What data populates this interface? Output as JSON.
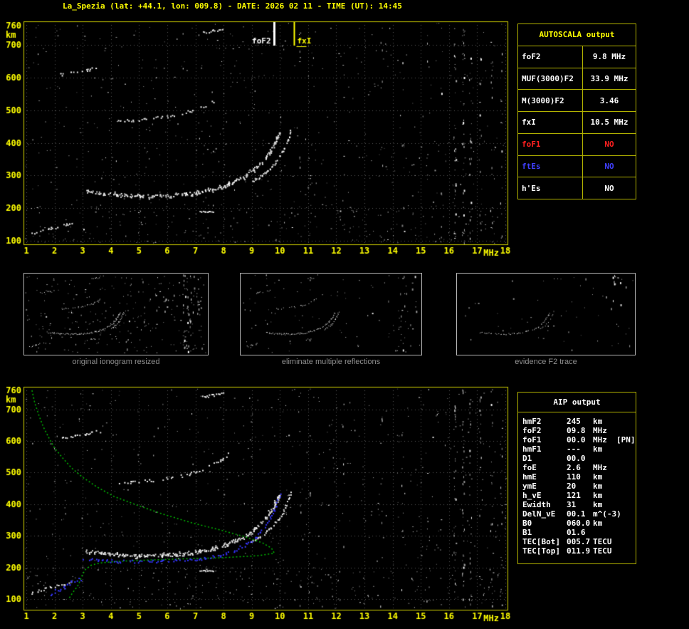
{
  "header": {
    "title": "La_Spezia (lat: +44.1, lon: 009.8) - DATE: 2026 02 11 - TIME (UT): 14:45"
  },
  "colors": {
    "background": "#000000",
    "axis_labels": "#ffff00",
    "plot_border": "#c8c800",
    "panel_border": "#b2b200",
    "trace_white": "#ffffff",
    "profile_green": "#00bb00",
    "restored_blue": "#3535ff",
    "fof1_red": "#ff2020",
    "ftes_blue": "#4040ff"
  },
  "autoscala": {
    "title": "AUTOSCALA output",
    "rows": [
      {
        "label": "foF2",
        "value": "9.8 MHz",
        "color": "#ffffff"
      },
      {
        "label": "MUF(3000)F2",
        "value": "33.9 MHz",
        "color": "#ffffff"
      },
      {
        "label": "M(3000)F2",
        "value": "3.46",
        "color": "#ffffff"
      },
      {
        "label": "fxI",
        "value": "10.5 MHz",
        "color": "#ffffff"
      },
      {
        "label": "foF1",
        "value": "NO",
        "color": "#ff2020"
      },
      {
        "label": "ftEs",
        "value": "NO",
        "color": "#4040ff"
      },
      {
        "label": "h'Es",
        "value": "NO",
        "color": "#ffffff"
      }
    ]
  },
  "thumbnails": [
    {
      "caption": "original ionogram resized"
    },
    {
      "caption": "eliminate multiple reflections"
    },
    {
      "caption": "evidence F2 trace"
    }
  ],
  "aip": {
    "title": "AIP output",
    "rows": [
      {
        "name": "hmF2",
        "value": "245",
        "unit": "km",
        "extra": ""
      },
      {
        "name": "foF2",
        "value": "09.8",
        "unit": "MHz",
        "extra": ""
      },
      {
        "name": "foF1",
        "value": "00.0",
        "unit": "MHz",
        "extra": "[PN]"
      },
      {
        "name": "hmF1",
        "value": "---",
        "unit": "km",
        "extra": ""
      },
      {
        "name": "D1",
        "value": "00.0",
        "unit": "",
        "extra": ""
      },
      {
        "name": "foE",
        "value": "2.6",
        "unit": "MHz",
        "extra": ""
      },
      {
        "name": "hmE",
        "value": "110",
        "unit": "km",
        "extra": ""
      },
      {
        "name": "ymE",
        "value": "20",
        "unit": "km",
        "extra": ""
      },
      {
        "name": "h_vE",
        "value": "121",
        "unit": "km",
        "extra": ""
      },
      {
        "name": "Ewidth",
        "value": "31",
        "unit": "km",
        "extra": ""
      },
      {
        "name": "DelN_vE",
        "value": "00.1",
        "unit": "m^(-3)",
        "extra": ""
      },
      {
        "name": "B0",
        "value": "060.0",
        "unit": "km",
        "extra": ""
      },
      {
        "name": "B1",
        "value": "01.6",
        "unit": "",
        "extra": ""
      },
      {
        "name": "TEC[Bot]",
        "value": "005.7",
        "unit": "TECU",
        "extra": ""
      },
      {
        "name": "TEC[Top]",
        "value": "011.9",
        "unit": "TECU",
        "extra": ""
      }
    ]
  },
  "chart_data": [
    {
      "id": "main_ionogram",
      "type": "scatter",
      "title": "scaled ionogram with AUTOSCALA frequency markers",
      "xlabel": "MHz",
      "ylabel": "km",
      "xlim": [
        1,
        18
      ],
      "ylim": [
        100,
        760
      ],
      "x_ticks": [
        1,
        2,
        3,
        4,
        5,
        6,
        7,
        8,
        9,
        10,
        11,
        12,
        13,
        14,
        15,
        16,
        17,
        18
      ],
      "y_ticks": [
        100,
        200,
        300,
        400,
        500,
        600,
        700,
        760
      ],
      "grid": true,
      "grid_color": "#585858",
      "border_color": "#c8c800",
      "annotations": [
        {
          "label": "foF2",
          "x": 9.8,
          "color": "#ffffff",
          "side": "left",
          "lw": 3
        },
        {
          "label": "fxI",
          "x": 10.5,
          "color": "#ffff00",
          "side": "right",
          "lw": 2,
          "underline": true
        }
      ],
      "traces": [
        {
          "name": "Es-trace",
          "points": [
            [
              1.15,
              122
            ],
            [
              1.5,
              130
            ],
            [
              1.9,
              139
            ],
            [
              2.3,
              148
            ],
            [
              2.65,
              157
            ]
          ],
          "keep": 0.55,
          "jitter": 1.5
        },
        {
          "name": "F2-trace",
          "points": [
            [
              3.1,
              254
            ],
            [
              3.6,
              248
            ],
            [
              4.2,
              243
            ],
            [
              5.0,
              239
            ],
            [
              5.8,
              239
            ],
            [
              6.5,
              243
            ],
            [
              7.1,
              250
            ],
            [
              7.6,
              259
            ],
            [
              8.0,
              270
            ],
            [
              8.4,
              284
            ],
            [
              8.8,
              303
            ],
            [
              9.15,
              326
            ],
            [
              9.45,
              352
            ],
            [
              9.65,
              375
            ],
            [
              9.8,
              398
            ],
            [
              9.9,
              416
            ],
            [
              9.97,
              432
            ]
          ],
          "keep": 0.9,
          "jitter": 1.6,
          "thick": true
        },
        {
          "name": "F2-trace-x",
          "points": [
            [
              9.0,
              282
            ],
            [
              9.35,
              302
            ],
            [
              9.65,
              325
            ],
            [
              9.9,
              350
            ],
            [
              10.08,
              375
            ],
            [
              10.2,
              398
            ],
            [
              10.3,
              420
            ],
            [
              10.36,
              438
            ]
          ],
          "keep": 0.75,
          "jitter": 1.2
        },
        {
          "name": "F2-second-hop",
          "points": [
            [
              4.25,
              467
            ],
            [
              4.8,
              471
            ],
            [
              5.4,
              476
            ],
            [
              6.0,
              483
            ],
            [
              6.6,
              493
            ],
            [
              7.1,
              506
            ],
            [
              7.5,
              521
            ],
            [
              7.85,
              540
            ],
            [
              8.15,
              560
            ]
          ],
          "keep": 0.45,
          "jitter": 1.4
        },
        {
          "name": "multiple-upper",
          "points": [
            [
              2.2,
              612
            ],
            [
              2.7,
              618
            ],
            [
              3.2,
              626
            ],
            [
              3.65,
              634
            ]
          ],
          "keep": 0.5,
          "jitter": 1.6
        },
        {
          "name": "top-trace",
          "points": [
            [
              7.25,
              740
            ],
            [
              7.6,
              746
            ],
            [
              7.95,
              751
            ]
          ],
          "keep": 0.7,
          "jitter": 1.2
        },
        {
          "name": "dash-190",
          "points": [
            [
              7.15,
              191
            ],
            [
              7.62,
              191
            ]
          ],
          "keep": 0.9,
          "jitter": 0.5
        }
      ],
      "noise_points": 520,
      "noise_band": {
        "km": [
          100,
          212
        ],
        "n": 150
      },
      "noise_columns": [
        {
          "f": 10.7,
          "n": 10
        },
        {
          "f": 11.05,
          "n": 7
        },
        {
          "f": 12.25,
          "n": 6
        },
        {
          "f": 13.6,
          "n": 9
        },
        {
          "f": 14.35,
          "n": 7
        },
        {
          "f": 15.2,
          "n": 6
        },
        {
          "f": 15.7,
          "n": 5
        },
        {
          "f": 16.2,
          "n": 34
        },
        {
          "f": 16.5,
          "n": 40
        },
        {
          "f": 16.75,
          "n": 26
        },
        {
          "f": 17.1,
          "n": 14
        },
        {
          "f": 17.5,
          "n": 18
        },
        {
          "f": 17.85,
          "n": 16
        }
      ]
    },
    {
      "id": "aip_ionogram",
      "type": "scatter",
      "title": "ionogram with restored trace and electron density profile",
      "xlabel": "MHz",
      "ylabel": "km",
      "xlim": [
        1,
        18
      ],
      "ylim": [
        100,
        760
      ],
      "x_ticks": [
        1,
        2,
        3,
        4,
        5,
        6,
        7,
        8,
        9,
        10,
        11,
        12,
        13,
        14,
        15,
        16,
        17,
        18
      ],
      "y_ticks": [
        100,
        200,
        300,
        400,
        500,
        600,
        700,
        760
      ],
      "grid": true,
      "grid_color": "#585858",
      "border_color": "#c8c800",
      "traces_same_as": "main_ionogram",
      "profile": {
        "name": "electron-density-profile",
        "color": "#00bb00",
        "points": [
          [
            1.2,
            760
          ],
          [
            1.3,
            720
          ],
          [
            1.45,
            680
          ],
          [
            1.6,
            645
          ],
          [
            1.8,
            610
          ],
          [
            2.0,
            578
          ],
          [
            2.3,
            545
          ],
          [
            2.6,
            515
          ],
          [
            3.0,
            485
          ],
          [
            3.5,
            455
          ],
          [
            4.1,
            425
          ],
          [
            4.9,
            398
          ],
          [
            5.8,
            370
          ],
          [
            6.8,
            343
          ],
          [
            7.9,
            318
          ],
          [
            8.8,
            296
          ],
          [
            9.4,
            277
          ],
          [
            9.7,
            261
          ],
          [
            9.8,
            245
          ],
          [
            9.2,
            237
          ],
          [
            8.0,
            231
          ],
          [
            6.5,
            227
          ],
          [
            5.2,
            223
          ],
          [
            4.2,
            219
          ],
          [
            3.6,
            214
          ],
          [
            3.3,
            207
          ],
          [
            3.1,
            194
          ],
          [
            3.0,
            179
          ],
          [
            2.93,
            164
          ],
          [
            2.87,
            150
          ],
          [
            2.8,
            138
          ],
          [
            2.7,
            127
          ],
          [
            2.62,
            117
          ],
          [
            2.55,
            107
          ],
          [
            2.5,
            100
          ]
        ]
      },
      "restored": [
        {
          "name": "restored-F2-trace",
          "color": "#3535ff",
          "points": [
            [
              2.95,
              228
            ],
            [
              3.5,
              224
            ],
            [
              4.2,
              221
            ],
            [
              5.0,
              220
            ],
            [
              5.8,
              221
            ],
            [
              6.5,
              224
            ],
            [
              7.3,
              230
            ],
            [
              7.9,
              240
            ],
            [
              8.4,
              255
            ],
            [
              8.8,
              275
            ],
            [
              9.15,
              300
            ],
            [
              9.45,
              330
            ],
            [
              9.65,
              358
            ],
            [
              9.8,
              385
            ],
            [
              9.9,
              410
            ],
            [
              9.98,
              430
            ]
          ],
          "keep": 0.8,
          "jitter": 1.6
        },
        {
          "name": "restored-E-cluster",
          "color": "#3535ff",
          "points": [
            [
              1.85,
              110
            ],
            [
              2.0,
              122
            ],
            [
              2.15,
              133
            ],
            [
              2.3,
              142
            ],
            [
              2.45,
              150
            ],
            [
              2.6,
              157
            ],
            [
              2.75,
              162
            ],
            [
              2.9,
              166
            ]
          ],
          "keep": 0.9,
          "jitter": 2.5
        }
      ],
      "noise_points": 520,
      "noise_band": {
        "km": [
          100,
          212
        ],
        "n": 160
      },
      "noise_columns_same_as": "main_ionogram"
    }
  ]
}
